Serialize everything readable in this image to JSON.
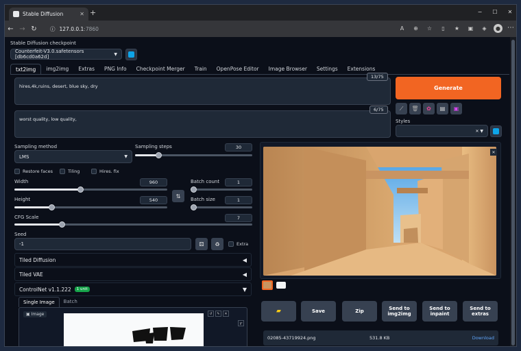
{
  "browser": {
    "tab_title": "Stable Diffusion",
    "url_host": "127.0.0.1",
    "url_port": ":7860",
    "window_controls": {
      "minimize": "−",
      "maximize": "☐",
      "close": "✕"
    }
  },
  "checkpoint": {
    "label": "Stable Diffusion checkpoint",
    "value": "Counterfeit-V3.0.safetensors [db6cd0a62d]"
  },
  "tabs": [
    "txt2img",
    "img2img",
    "Extras",
    "PNG Info",
    "Checkpoint Merger",
    "Train",
    "OpenPose Editor",
    "Image Browser",
    "Settings",
    "Extensions"
  ],
  "prompt": {
    "text": "hires,4k,ruins, desert, blue sky, dry",
    "count": "13/75"
  },
  "negative_prompt": {
    "text": "worst quality, low quality,",
    "count": "6/75"
  },
  "generate_label": "Generate",
  "styles": {
    "label": "Styles"
  },
  "sampling": {
    "method_label": "Sampling method",
    "method_value": "LMS",
    "steps_label": "Sampling steps",
    "steps_value": "30",
    "steps_fraction": 0.2
  },
  "checkboxes": {
    "restore_faces": "Restore faces",
    "tiling": "Tiling",
    "hires_fix": "Hires. fix",
    "extra": "Extra"
  },
  "width": {
    "label": "Width",
    "value": "960",
    "fraction": 0.43
  },
  "height": {
    "label": "Height",
    "value": "540",
    "fraction": 0.24
  },
  "batch_count": {
    "label": "Batch count",
    "value": "1",
    "fraction": 0.0
  },
  "batch_size": {
    "label": "Batch size",
    "value": "1",
    "fraction": 0.0
  },
  "cfg": {
    "label": "CFG Scale",
    "value": "7",
    "fraction": 0.2
  },
  "seed": {
    "label": "Seed",
    "value": "-1"
  },
  "accordions": {
    "tiled_diffusion": "Tiled Diffusion",
    "tiled_vae": "Tiled VAE",
    "controlnet": "ControlNet v1.1.222",
    "controlnet_badge": "1 unit"
  },
  "controlnet_tabs": {
    "single": "Single Image",
    "batch": "Batch"
  },
  "image_label": "Image",
  "output_buttons": [
    "Save",
    "Zip",
    "Send to img2img",
    "Send to inpaint",
    "Send to extras"
  ],
  "output_file": {
    "name": "02085-43719924.png",
    "size": "531.8 KB",
    "download": "Download"
  },
  "colors": {
    "accent": "#f26522",
    "bg": "#0b0f19",
    "input": "#1f2937"
  }
}
